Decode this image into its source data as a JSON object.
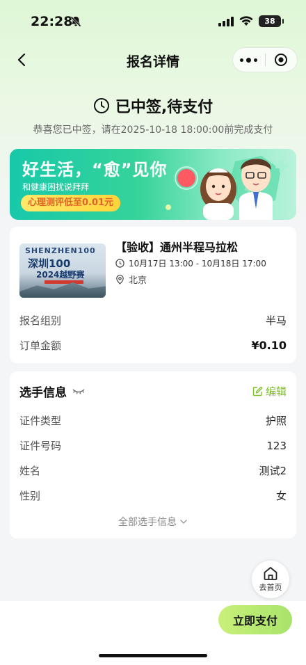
{
  "status_bar": {
    "time": "22:28",
    "battery": "38"
  },
  "nav": {
    "title": "报名详情"
  },
  "status": {
    "title": "已中签,待支付",
    "subtitle": "恭喜您已中签，请在2025-10-18 18:00:00前完成支付"
  },
  "banner": {
    "title": "好生活，“愈”见你",
    "subtitle": "和健康困扰说拜拜",
    "pill": "心理测评低至0.01元"
  },
  "event": {
    "thumb_line1": "SHENZHEN100",
    "thumb_line2": "深圳100",
    "thumb_line3": "2024越野赛",
    "title": "【验收】通州半程马拉松",
    "time": "10月17日 13:00 - 10月18日 17:00",
    "location": "北京",
    "rows": [
      {
        "label": "报名组别",
        "value": "半马"
      },
      {
        "label": "订单金额",
        "value": "¥0.10"
      }
    ]
  },
  "athlete": {
    "title": "选手信息",
    "edit_label": "编辑",
    "rows": [
      {
        "label": "证件类型",
        "value": "护照"
      },
      {
        "label": "证件号码",
        "value": "123"
      },
      {
        "label": "姓名",
        "value": "测试2"
      },
      {
        "label": "性别",
        "value": "女"
      }
    ],
    "more_label": "全部选手信息"
  },
  "fab": {
    "label": "去首页"
  },
  "footer": {
    "pay_label": "立即支付"
  },
  "colors": {
    "accent": "#7fbf2a",
    "pay_button": "#b7e96f",
    "banner": "#2ecfa3"
  },
  "icons": [
    "bell-slash-icon",
    "signal-icon",
    "wifi-icon",
    "back-icon",
    "more-dots-icon",
    "target-icon",
    "clock-icon",
    "location-icon",
    "eye-closed-icon",
    "edit-icon",
    "chevron-down-icon",
    "home-icon"
  ]
}
